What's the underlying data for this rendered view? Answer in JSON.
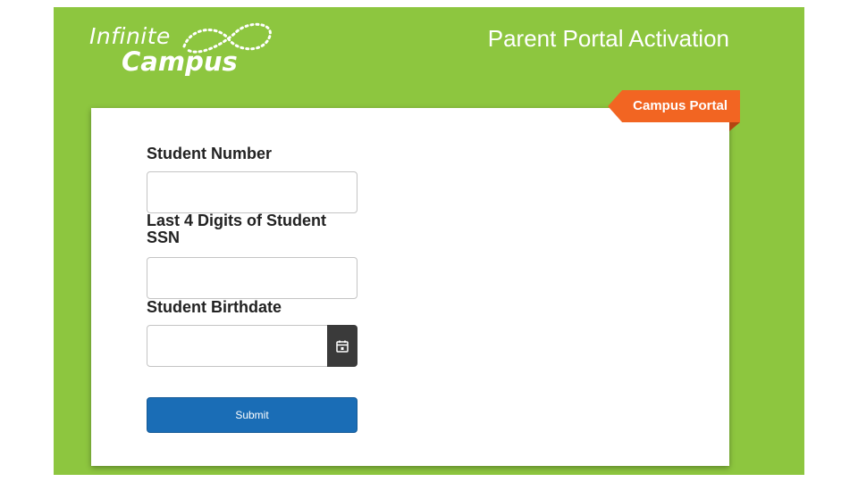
{
  "logo": {
    "line1": "Infinite",
    "line2": "Campus"
  },
  "header": {
    "title": "Parent Portal Activation"
  },
  "ribbon": {
    "label": "Campus Portal"
  },
  "form": {
    "student_number": {
      "label": "Student Number",
      "value": "",
      "placeholder": ""
    },
    "ssn": {
      "label": "Last 4 Digits of Student SSN",
      "value": "",
      "placeholder": ""
    },
    "birthdate": {
      "label": "Student Birthdate",
      "value": "",
      "placeholder": ""
    },
    "submit_label": "Submit"
  },
  "colors": {
    "brand_green": "#8dc63f",
    "ribbon_orange": "#f26522",
    "submit_blue": "#1a6db6",
    "date_button": "#3a3a3a"
  },
  "icons": {
    "date_button": "calendar-icon",
    "logo_mark": "infinity-swoosh-icon"
  }
}
